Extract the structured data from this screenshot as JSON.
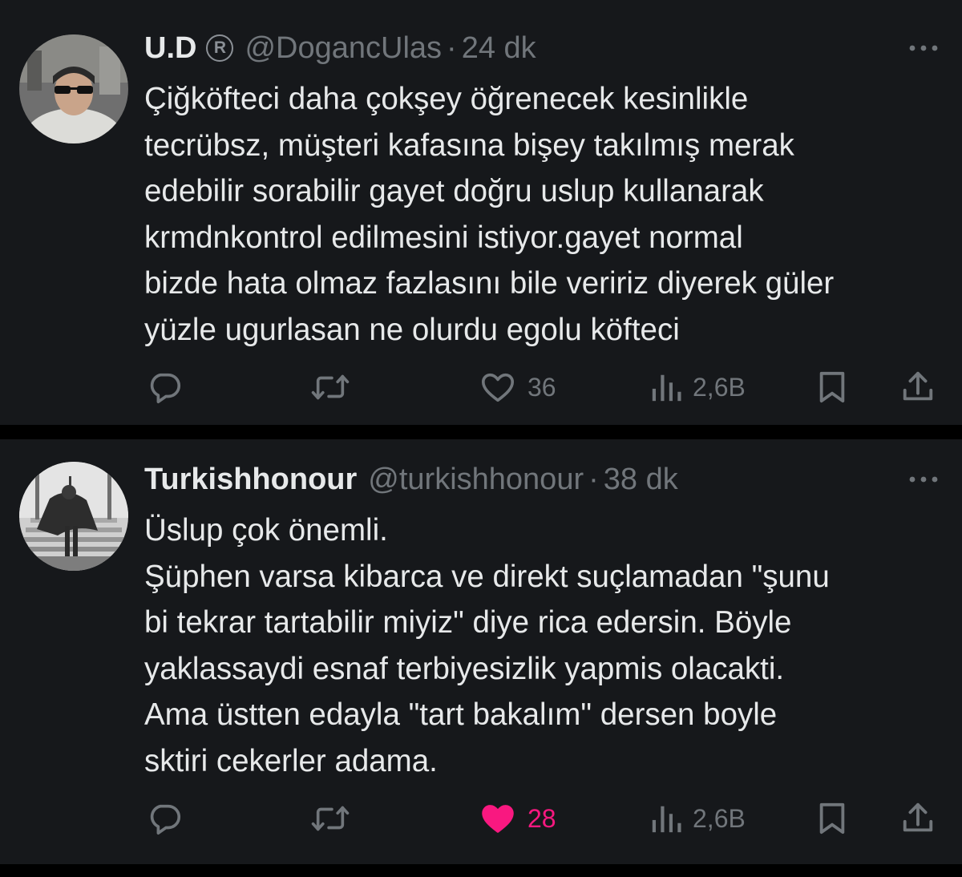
{
  "tweets": [
    {
      "name": "U.D",
      "badge": "R",
      "handle": "@DogancUlas",
      "separator": "·",
      "time": "24 dk",
      "lines": [
        "Çiğköfteci daha çokşey öğrenecek kesinlikle",
        "tecrübsz, müşteri kafasına bişey takılmış merak",
        "edebilir sorabilir gayet doğru uslup kullanarak",
        "krmdnkontrol edilmesini istiyor.gayet normal",
        "bizde hata olmaz fazlasını bile veririz diyerek güler",
        "yüzle ugurlasan ne olurdu egolu köfteci"
      ],
      "likes": "36",
      "views": "2,6B",
      "liked": false
    },
    {
      "name": "Turkishhonour",
      "handle": "@turkishhonour",
      "separator": "·",
      "time": "38 dk",
      "lines": [
        "Üslup çok önemli.",
        "Şüphen varsa kibarca ve direkt suçlamadan \"şunu",
        "bi tekrar tartabilir miyiz\" diye rica edersin. Böyle",
        "yaklassaydi esnaf terbiyesizlik yapmis olacakti.",
        "Ama üstten edayla \"tart bakalım\" dersen boyle",
        "sktiri cekerler adama."
      ],
      "likes": "28",
      "views": "2,6B",
      "liked": true
    }
  ],
  "icons": {
    "reply": "reply-icon",
    "retweet": "retweet-icon",
    "like": "heart-icon",
    "views": "views-icon",
    "bookmark": "bookmark-icon",
    "share": "share-icon",
    "more": "more-icon"
  },
  "colors": {
    "background": "#000000",
    "card": "#16181b",
    "text": "#e7e9ea",
    "muted": "#71767b",
    "like": "#f91880"
  }
}
